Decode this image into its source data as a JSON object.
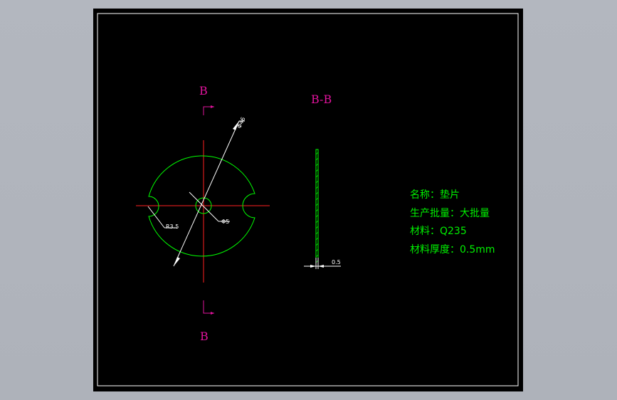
{
  "section_marker": {
    "top_letter": "B",
    "bottom_letter": "B",
    "section_title": "B-B"
  },
  "dimensions": {
    "outer_diameter": "Φ46",
    "hole_diameter": "Φ5",
    "notch_radius": "R3.5",
    "thickness": "0.5"
  },
  "title_block": {
    "name": "名称：垫片",
    "batch": "生产批量：大批量",
    "material": "材料：Q235",
    "thickness": "材料厚度：0.5mm"
  },
  "colors": {
    "sheet_background": "#000000",
    "part_outline": "#00ff00",
    "center_lines": "#ff0000",
    "section_marks": "#e0139c",
    "dimension_lines": "#ffffff",
    "label_text": "#00f000"
  }
}
